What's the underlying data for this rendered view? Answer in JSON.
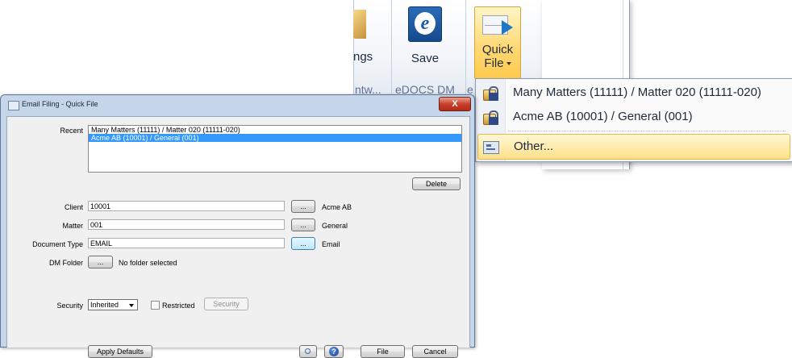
{
  "ribbon": {
    "settings_label": "ngs",
    "save_label": "Save",
    "quick_file_label_line1": "Quick",
    "quick_file_label_line2": "File",
    "group_partial": "ntw...",
    "group_edocs": "eDOCS DM",
    "group_partial2": "e"
  },
  "menu": {
    "items": [
      {
        "label": "Many Matters (11111) / Matter 020 (11111-020)"
      },
      {
        "label": "Acme AB (10001) / General (001)"
      },
      {
        "label": "Other..."
      }
    ]
  },
  "dialog": {
    "title": "Email Filing - Quick File",
    "close_label": "X",
    "recent_label": "Recent",
    "recent_items": [
      "Many Matters (11111) / Matter 020 (11111-020)",
      "Acme AB (10001) / General (001)"
    ],
    "delete_label": "Delete",
    "client_label": "Client",
    "client_value": "10001",
    "client_name": "Acme AB",
    "matter_label": "Matter",
    "matter_value": "001",
    "matter_name": "General",
    "doctype_label": "Document Type",
    "doctype_value": "EMAIL",
    "doctype_name": "Email",
    "browse_label": "...",
    "dmfolder_label": "DM Folder",
    "dmfolder_value": "No folder selected",
    "security_label": "Security",
    "security_value": "Inherited",
    "restricted_label": "Restricted",
    "security_button_label": "Security",
    "apply_defaults_label": "Apply Defaults",
    "help_label": "?",
    "file_label": "File",
    "cancel_label": "Cancel"
  }
}
